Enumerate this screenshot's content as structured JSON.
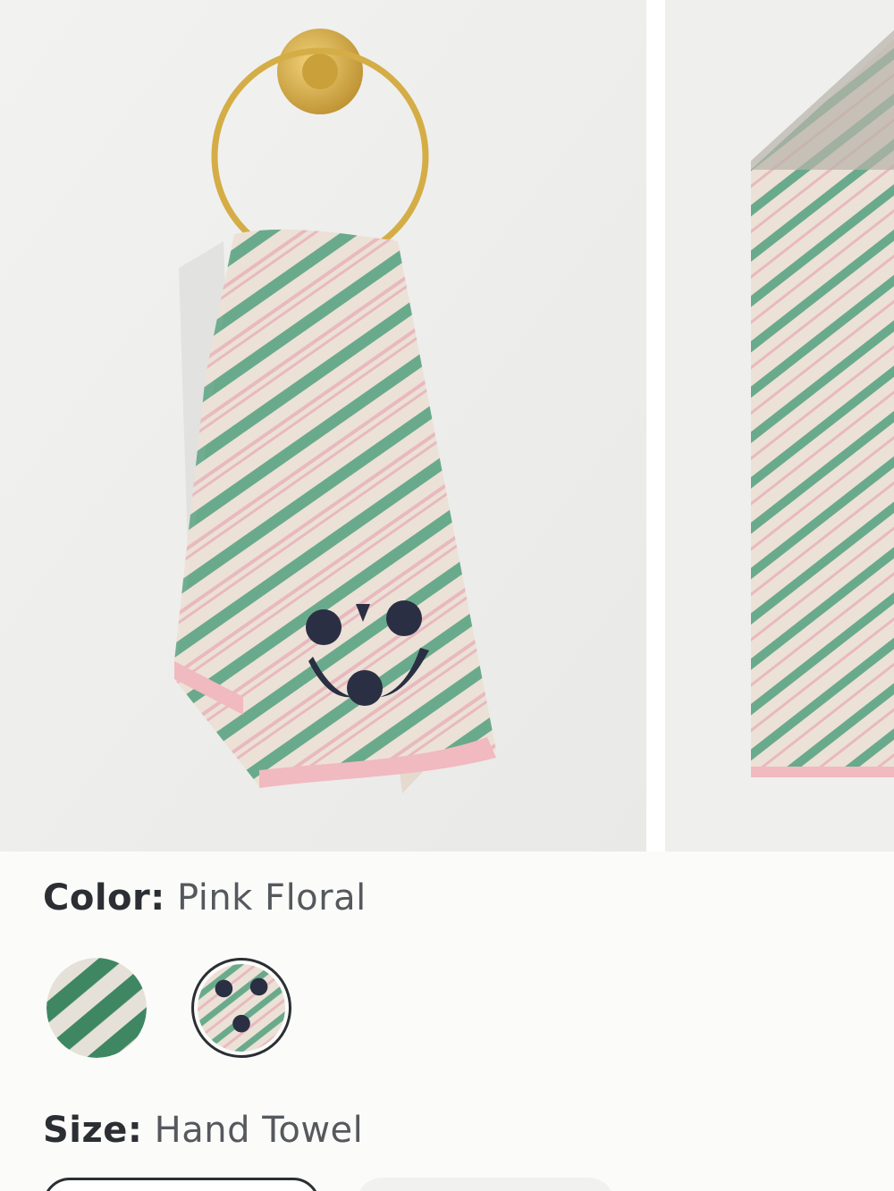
{
  "color": {
    "label": "Color:",
    "value": "Pink Floral"
  },
  "size": {
    "label": "Size:",
    "value": "Hand Towel"
  },
  "swatches": [
    {
      "name": "green-stripe",
      "selected": false
    },
    {
      "name": "pink-floral",
      "selected": true
    }
  ],
  "gallery": {
    "images": [
      "hand-towel-on-gold-ring",
      "towel-stripes-closeup"
    ]
  },
  "colors": {
    "stripe_green": "#6aaa8c",
    "stripe_pink": "#e8b9bf",
    "towel_base": "#ece1d6",
    "hem_pink": "#f1b9c0",
    "brass": "#d4ad46",
    "embroidery": "#2a2f44"
  }
}
